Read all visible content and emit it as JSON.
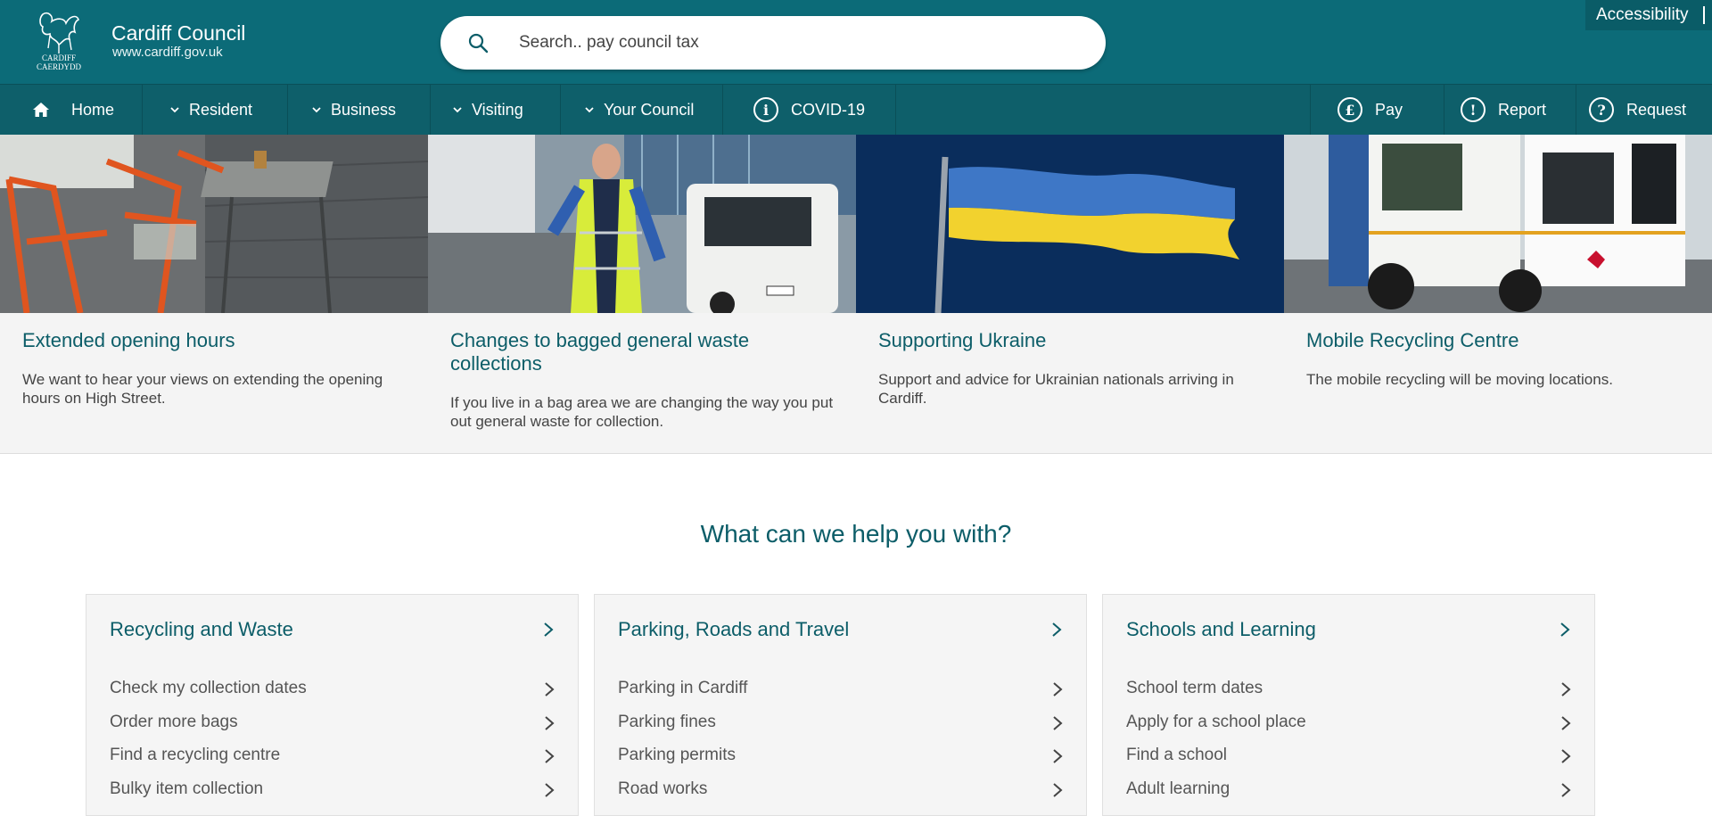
{
  "header": {
    "brand_name": "Cardiff Council",
    "brand_url": "www.cardiff.gov.uk",
    "logo_text_top": "CARDIFF",
    "logo_text_bottom": "CAERDYDD",
    "search_placeholder": "Search.. pay council tax",
    "accessibility_label": "Accessibility"
  },
  "nav": {
    "items": [
      {
        "label": "Home",
        "icon": "home-icon"
      },
      {
        "label": "Resident",
        "icon": "chevron-down-icon"
      },
      {
        "label": "Business",
        "icon": "chevron-down-icon"
      },
      {
        "label": "Visiting",
        "icon": "chevron-down-icon"
      },
      {
        "label": "Your Council",
        "icon": "chevron-down-icon"
      },
      {
        "label": "COVID-19",
        "icon": "info-icon",
        "glyph": "i"
      }
    ],
    "right_items": [
      {
        "label": "Pay",
        "icon": "pound-icon",
        "glyph": "£"
      },
      {
        "label": "Report",
        "icon": "exclamation-icon",
        "glyph": "!"
      },
      {
        "label": "Request",
        "icon": "question-icon",
        "glyph": "?"
      }
    ]
  },
  "cards": [
    {
      "title": "Extended opening hours",
      "text": "We want to hear your views on extending the opening hours on High Street."
    },
    {
      "title": "Changes to bagged general waste collections",
      "text": "If you live in a bag area we are changing the way you put out general waste for collection."
    },
    {
      "title": "Supporting Ukraine",
      "text": "Support and advice for Ukrainian nationals arriving in Cardiff."
    },
    {
      "title": "Mobile Recycling Centre",
      "text": "The mobile recycling will be moving locations."
    }
  ],
  "help": {
    "heading": "What can we help you with?",
    "panels": [
      {
        "title": "Recycling and Waste",
        "links": [
          "Check my collection dates",
          "Order more bags",
          "Find a recycling centre",
          "Bulky item collection"
        ]
      },
      {
        "title": "Parking, Roads and Travel",
        "links": [
          "Parking in Cardiff",
          "Parking fines",
          "Parking permits",
          "Road works"
        ]
      },
      {
        "title": "Schools and Learning",
        "links": [
          "School term dates",
          "Apply for a school place",
          "Find a school",
          "Adult learning"
        ]
      }
    ]
  },
  "colors": {
    "header_bg": "#0c6b78",
    "nav_bg": "#0e5f6a",
    "accent_text": "#0c5d68",
    "card_bg": "#f4f4f4"
  }
}
